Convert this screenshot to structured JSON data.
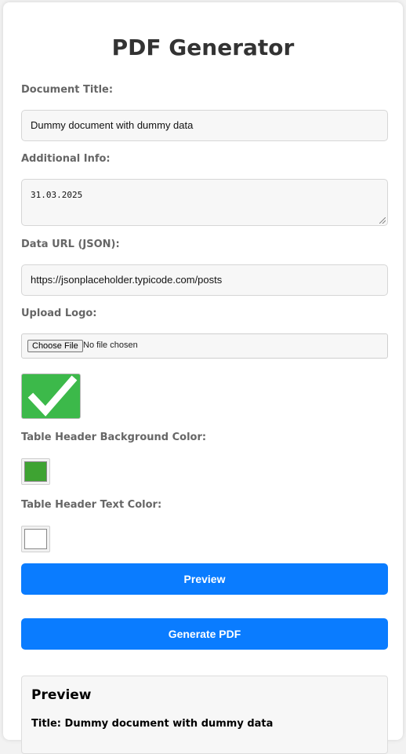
{
  "header": {
    "title": "PDF Generator"
  },
  "form": {
    "document_title": {
      "label": "Document Title:",
      "value": "Dummy document with dummy data"
    },
    "additional_info": {
      "label": "Additional Info:",
      "value": "31.03.2025"
    },
    "data_url": {
      "label": "Data URL (JSON):",
      "value": "https://jsonplaceholder.typicode.com/posts"
    },
    "upload_logo": {
      "label": "Upload Logo:",
      "button_label": "Choose File",
      "status": "No file chosen",
      "logo_icon": "checkmark-icon"
    },
    "table_header_bg_color": {
      "label": "Table Header Background Color:",
      "value": "#3ea332"
    },
    "table_header_text_color": {
      "label": "Table Header Text Color:",
      "value": "#ffffff"
    }
  },
  "actions": {
    "preview_label": "Preview",
    "generate_label": "Generate PDF",
    "accent_color": "#0a7cff"
  },
  "preview": {
    "heading": "Preview",
    "title_line": "Title: Dummy document with dummy data"
  }
}
